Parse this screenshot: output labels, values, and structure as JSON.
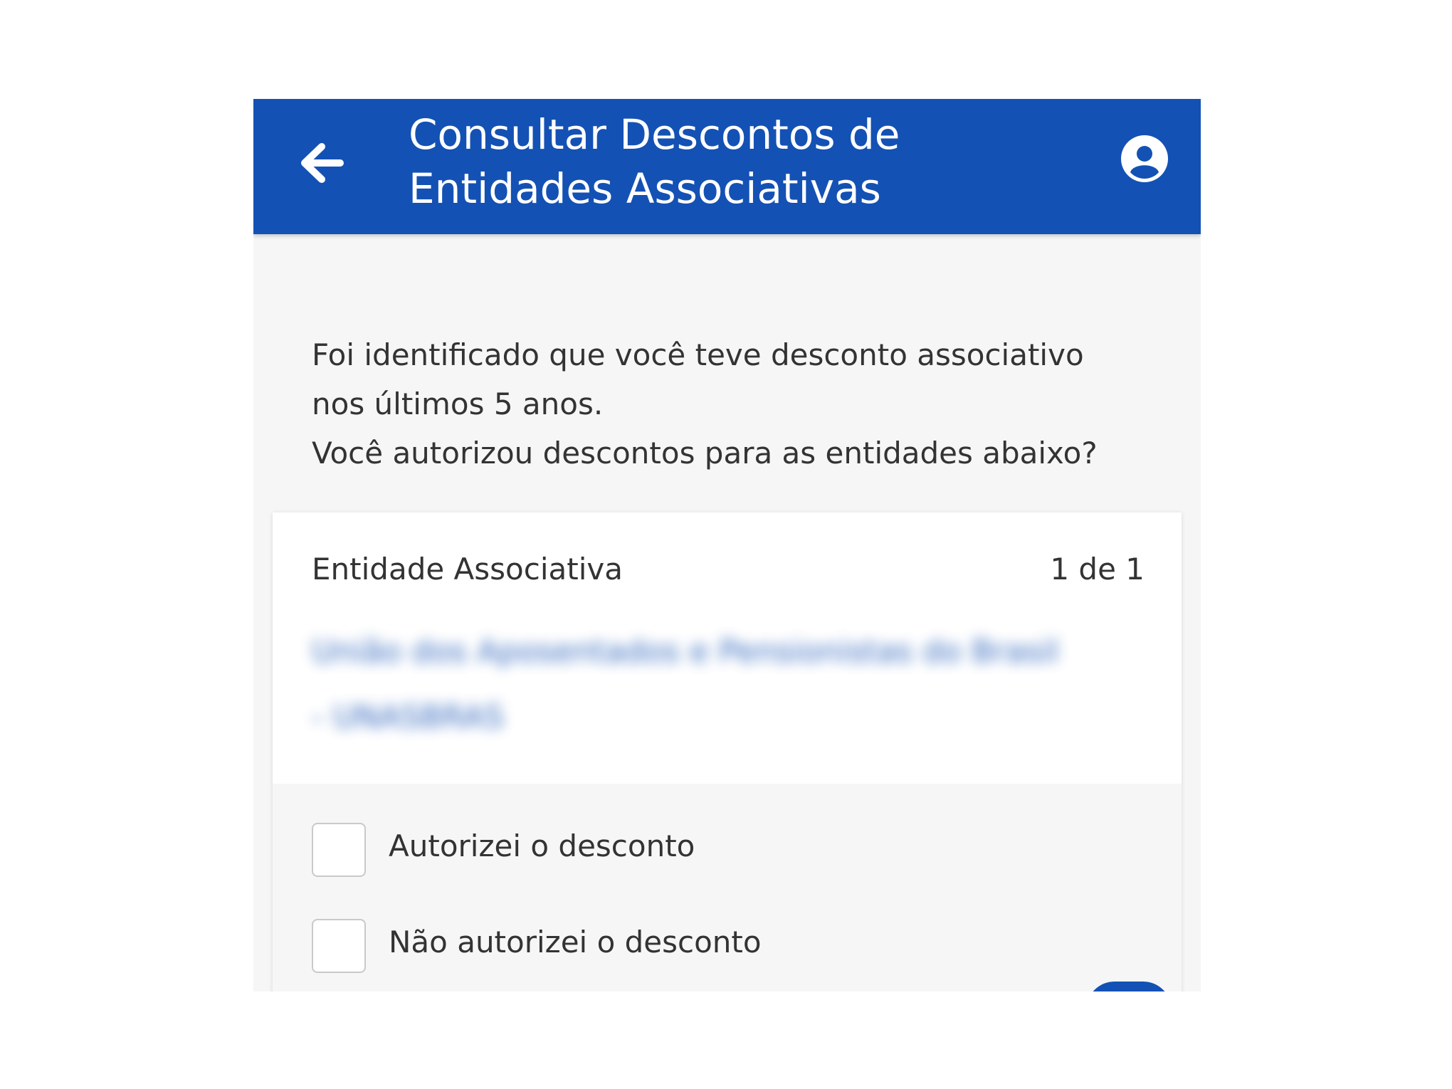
{
  "header": {
    "title": "Consultar Descontos de Entidades Associativas",
    "back_icon": "arrow-left-icon",
    "user_icon": "user-circle-icon",
    "background_color": "#1451b4"
  },
  "intro": {
    "line1": "Foi identificado que você teve desconto associativo",
    "line2": "nos últimos 5 anos.",
    "line3": "Você autorizou descontos para as entidades abaixo?"
  },
  "card": {
    "label": "Entidade Associativa",
    "count": "1 de 1",
    "entity_name": "União dos Aposentados e Pensionistas do Brasil - UNASBRAS",
    "options": [
      {
        "label": "Autorizei o desconto",
        "checked": false
      },
      {
        "label": "Não autorizei o desconto",
        "checked": false
      }
    ]
  }
}
